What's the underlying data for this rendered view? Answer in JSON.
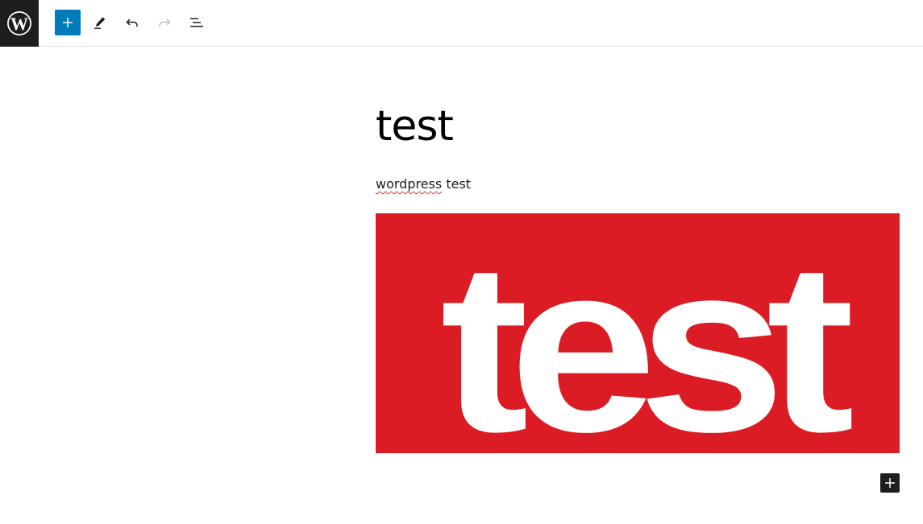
{
  "editor": {
    "logo": "wordpress-icon",
    "toolbar": {
      "add_icon": "plus-icon",
      "edit_icon": "pencil-icon",
      "undo_icon": "undo-icon",
      "redo_icon": "redo-icon",
      "outline_icon": "list-view-icon",
      "add_color": "#007cba"
    }
  },
  "post": {
    "title": "test",
    "paragraph_spelled": "wordpress",
    "paragraph_rest": " test",
    "image": {
      "text": "test",
      "background": "#dc1c24",
      "text_color": "#ffffff"
    }
  },
  "appender": {
    "icon": "plus-icon"
  }
}
